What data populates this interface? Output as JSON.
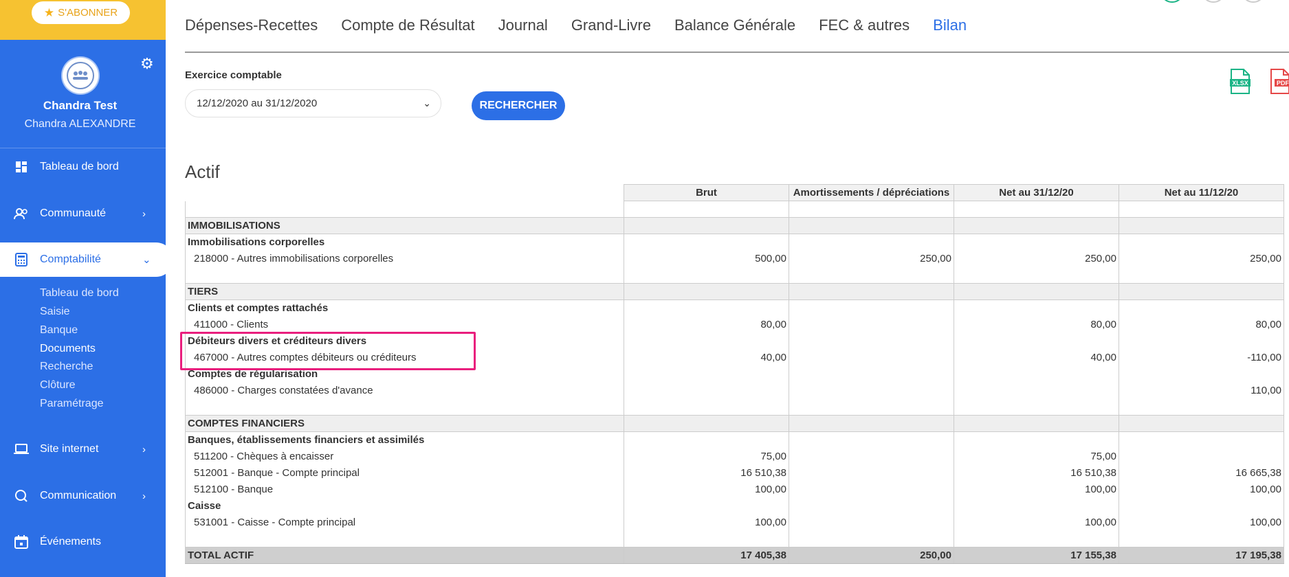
{
  "sidebar": {
    "subscribe_label": "S'ABONNER",
    "user_name": "Chandra Test",
    "user_sub": "Chandra ALEXANDRE",
    "nav": [
      {
        "label": "Tableau de bord",
        "icon": "dashboard-icon"
      },
      {
        "label": "Communauté",
        "icon": "community-icon"
      },
      {
        "label": "Comptabilité",
        "icon": "calculator-icon"
      },
      {
        "label": "Site internet",
        "icon": "laptop-icon"
      },
      {
        "label": "Communication",
        "icon": "chat-icon"
      },
      {
        "label": "Événements",
        "icon": "calendar-icon"
      }
    ],
    "subnav": [
      "Tableau de bord",
      "Saisie",
      "Banque",
      "Documents",
      "Recherche",
      "Clôture",
      "Paramétrage"
    ]
  },
  "tabs": [
    "Dépenses-Recettes",
    "Compte de Résultat",
    "Journal",
    "Grand-Livre",
    "Balance Générale",
    "FEC & autres",
    "Bilan"
  ],
  "filter": {
    "label": "Exercice comptable",
    "selected": "12/12/2020 au 31/12/2020",
    "search_label": "RECHERCHER"
  },
  "exports": {
    "xlsx": "XLSX",
    "pdf": "PDF"
  },
  "section_title": "Actif",
  "table": {
    "headers": [
      "Brut",
      "Amortissements / dépréciations",
      "Net au 31/12/20",
      "Net au 11/12/20"
    ],
    "rows": [
      {
        "type": "blank"
      },
      {
        "type": "section",
        "label": "IMMOBILISATIONS"
      },
      {
        "type": "subhead",
        "label": "Immobilisations corporelles"
      },
      {
        "type": "account",
        "label": "218000 - Autres immobilisations corporelles",
        "values": [
          "500,00",
          "250,00",
          "250,00",
          "250,00"
        ]
      },
      {
        "type": "spacer"
      },
      {
        "type": "section",
        "label": "TIERS"
      },
      {
        "type": "subhead",
        "label": "Clients et comptes rattachés"
      },
      {
        "type": "account",
        "label": "411000 - Clients",
        "values": [
          "80,00",
          "",
          "80,00",
          "80,00"
        ]
      },
      {
        "type": "subhead",
        "label": "Débiteurs divers et créditeurs divers"
      },
      {
        "type": "account",
        "label": "467000 - Autres comptes débiteurs ou créditeurs",
        "values": [
          "40,00",
          "",
          "40,00",
          "-110,00"
        ]
      },
      {
        "type": "subhead",
        "label": "Comptes de régularisation"
      },
      {
        "type": "account",
        "label": "486000 - Charges constatées d'avance",
        "values": [
          "",
          "",
          "",
          "110,00"
        ]
      },
      {
        "type": "spacer"
      },
      {
        "type": "section",
        "label": "COMPTES FINANCIERS"
      },
      {
        "type": "subhead",
        "label": "Banques, établissements financiers et assimilés"
      },
      {
        "type": "account",
        "label": "511200 - Chèques à encaisser",
        "values": [
          "75,00",
          "",
          "75,00",
          ""
        ]
      },
      {
        "type": "account",
        "label": "512001 - Banque - Compte principal",
        "values": [
          "16 510,38",
          "",
          "16 510,38",
          "16 665,38"
        ]
      },
      {
        "type": "account",
        "label": "512100 - Banque",
        "values": [
          "100,00",
          "",
          "100,00",
          "100,00"
        ]
      },
      {
        "type": "subhead",
        "label": "Caisse"
      },
      {
        "type": "account",
        "label": "531001 - Caisse - Compte principal",
        "values": [
          "100,00",
          "",
          "100,00",
          "100,00"
        ]
      },
      {
        "type": "spacer"
      },
      {
        "type": "total",
        "label": "TOTAL ACTIF",
        "values": [
          "17 405,38",
          "250,00",
          "17 155,38",
          "17 195,38"
        ]
      }
    ]
  },
  "colors": {
    "primary": "#2c6fe6",
    "subscribe": "#f6c231",
    "highlight": "#e91e7d"
  }
}
